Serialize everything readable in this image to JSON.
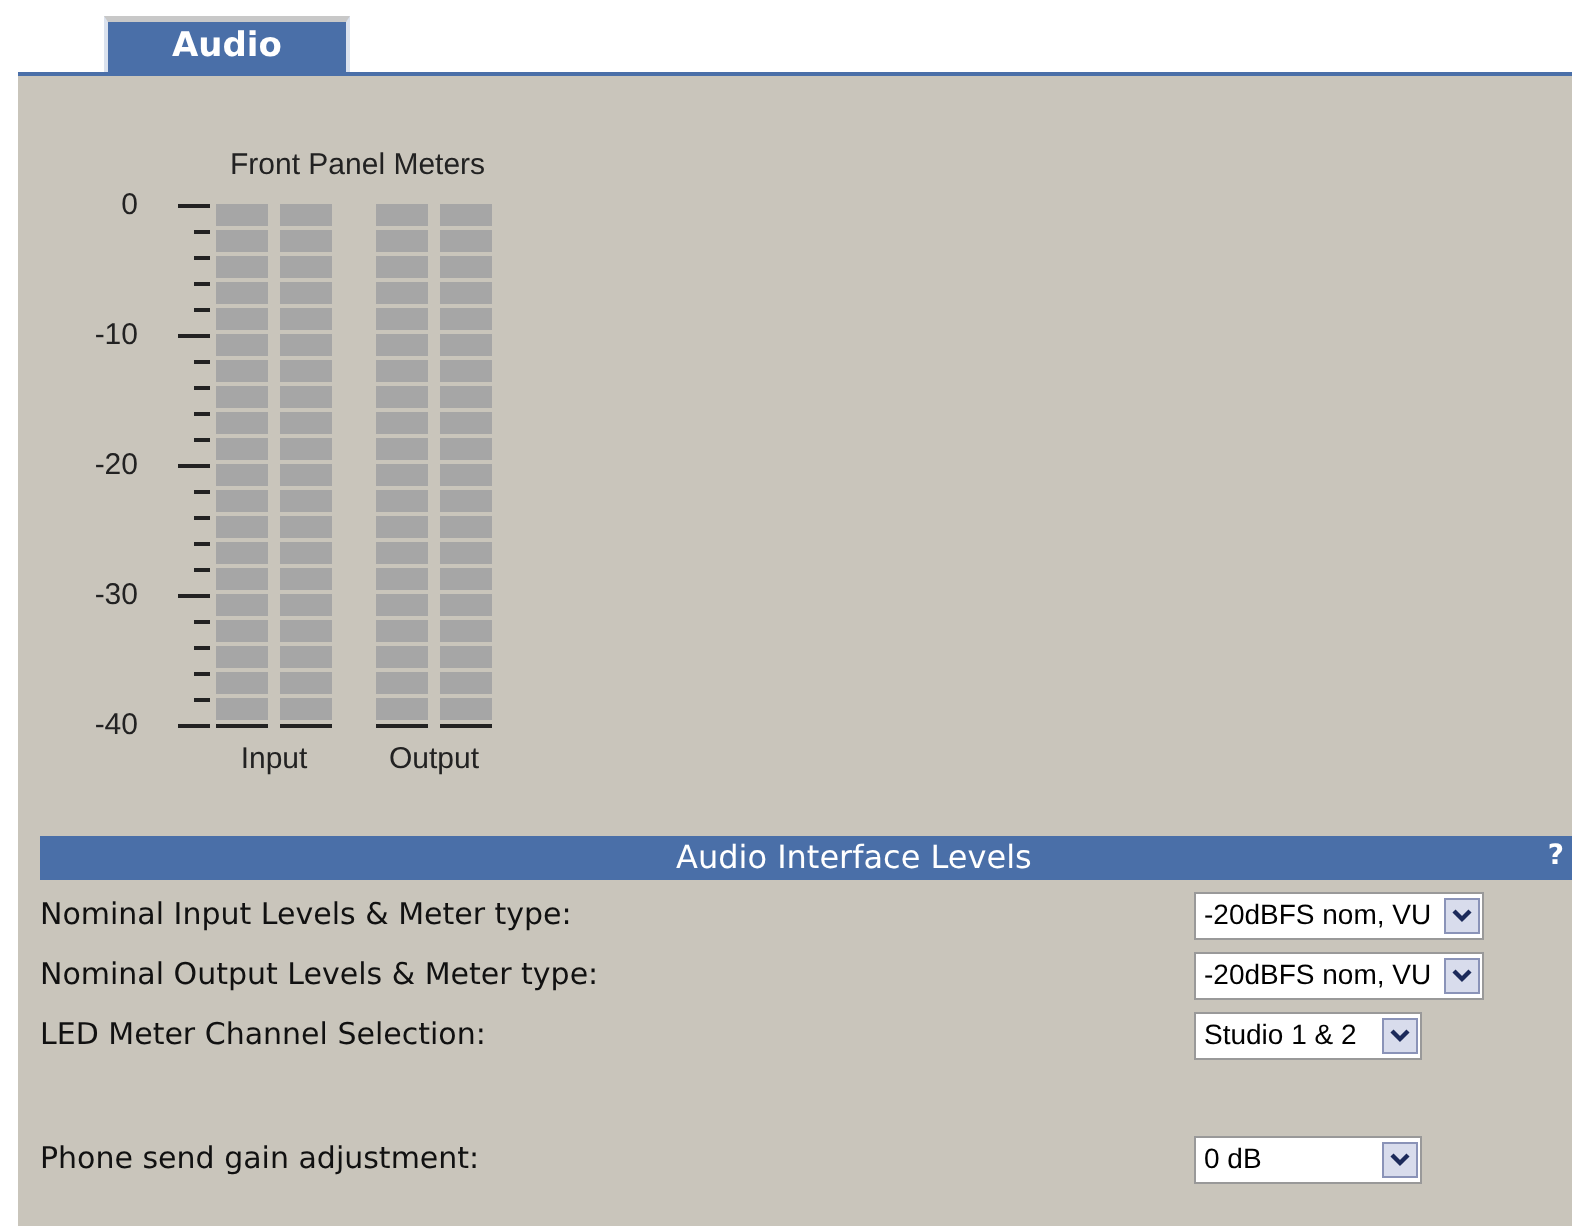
{
  "tabs": [
    {
      "label": "Audio",
      "selected": true
    }
  ],
  "meters": {
    "title": "Front Panel Meters",
    "scale": [
      "0",
      "-10",
      "-20",
      "-30",
      "-40"
    ],
    "groups": [
      {
        "label": "Input",
        "channels": [
          {
            "level": 0
          },
          {
            "level": 0
          }
        ]
      },
      {
        "label": "Output",
        "channels": [
          {
            "level": 0
          },
          {
            "level": 0
          }
        ]
      }
    ]
  },
  "section": {
    "title": "Audio Interface Levels",
    "help": "?"
  },
  "settings": [
    {
      "label": "Nominal Input Levels & Meter type:",
      "value": "-20dBFS nom, VU"
    },
    {
      "label": "Nominal Output Levels & Meter type:",
      "value": "-20dBFS nom, VU"
    },
    {
      "label": "LED Meter Channel Selection:",
      "value": "Studio 1 & 2"
    }
  ],
  "phone_settings": [
    {
      "label": "Phone send gain adjustment:",
      "value": "0 dB"
    }
  ]
}
